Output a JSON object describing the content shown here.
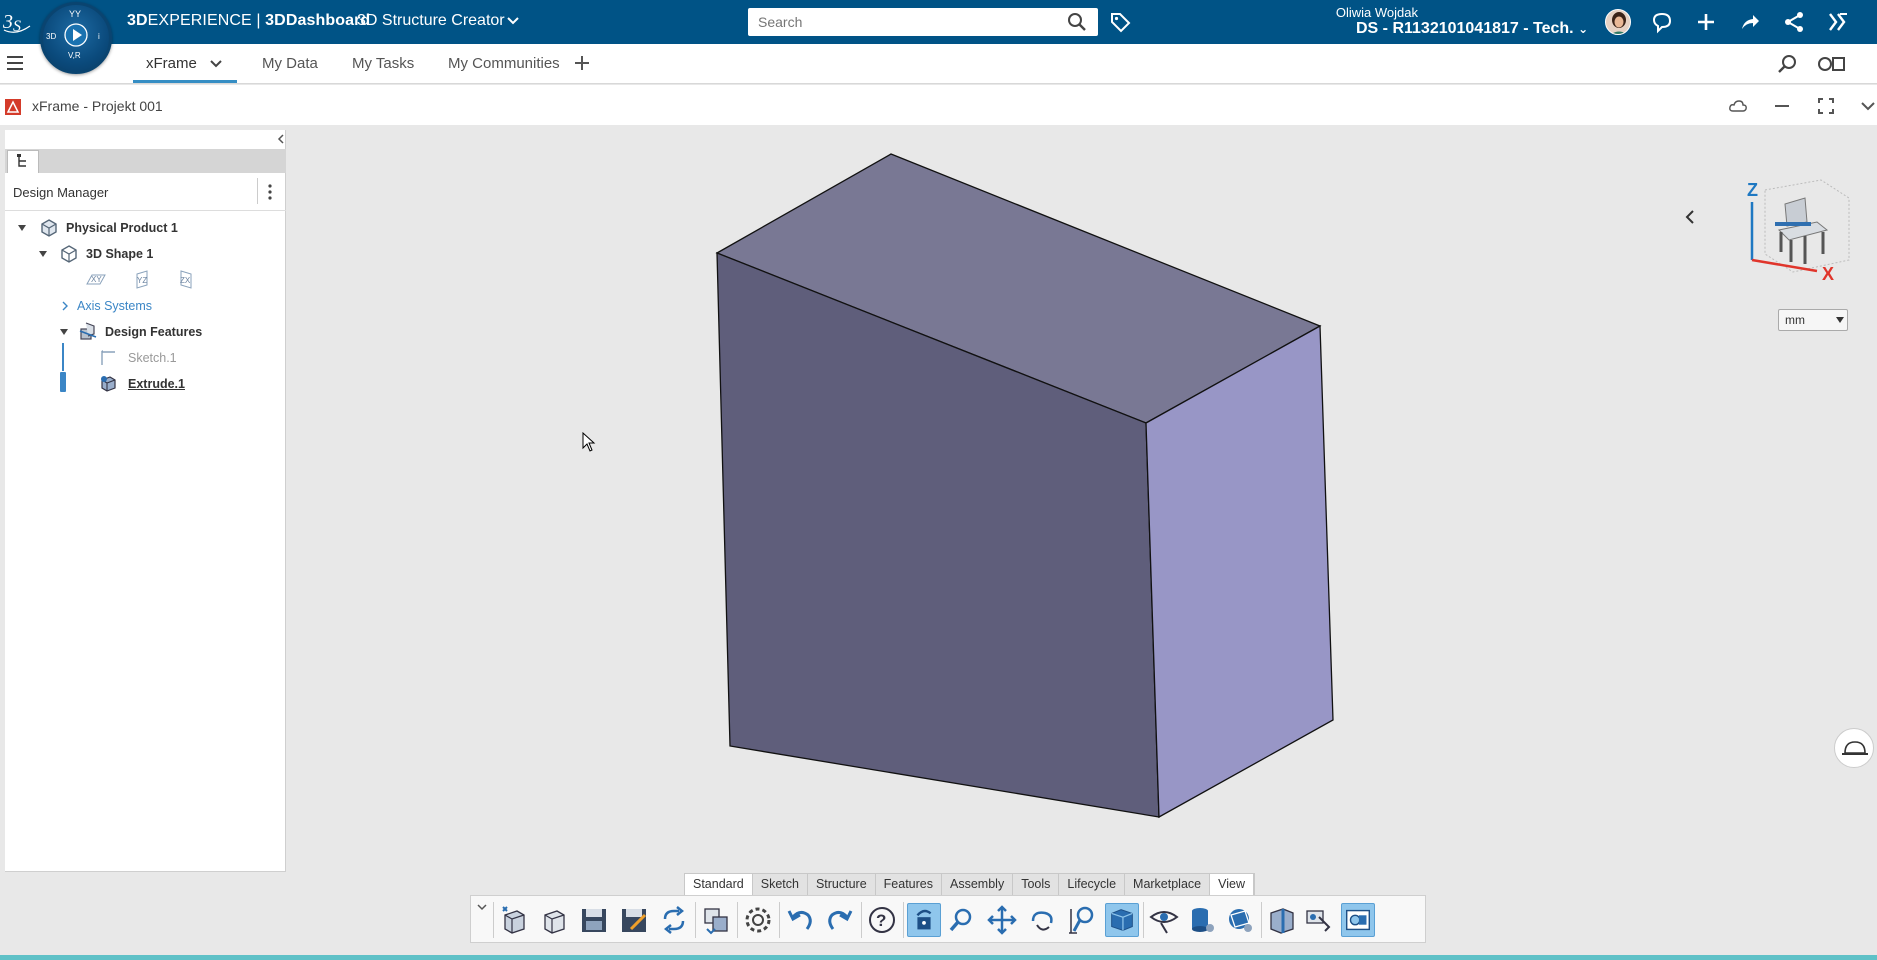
{
  "topbar": {
    "brand_bold": "3D",
    "brand_rest": "EXPERIENCE",
    "brand_sep": " | ",
    "brand_dash_bold": "3D",
    "brand_dash_rest": "Dashboard",
    "app_name": "3D Structure Creator",
    "compass_labels": {
      "top": "V,R",
      "left": "3D",
      "center": "i"
    },
    "search_placeholder": "Search",
    "user_name": "Oliwia Wojdak",
    "tenant": "DS - R1132101041817 - Tech.",
    "icons": [
      "search-icon",
      "tag-icon",
      "chat-icon",
      "add-icon",
      "share-icon",
      "network-icon",
      "tools-icon"
    ],
    "brand_color": "#005386"
  },
  "tabs": {
    "items": [
      "xFrame",
      "My Data",
      "My Tasks",
      "My Communities"
    ],
    "active": "xFrame"
  },
  "window": {
    "title": "xFrame - Projekt 001"
  },
  "design_manager": {
    "title": "Design Manager",
    "tree": [
      {
        "label": "Physical Product 1",
        "bold": true,
        "expanded": true
      },
      {
        "label": "3D Shape 1",
        "bold": true,
        "expanded": true
      },
      {
        "planes": [
          "XY",
          "YZ",
          "ZX"
        ]
      },
      {
        "label": "Axis Systems",
        "expanded": false,
        "color": "#3b86c6"
      },
      {
        "label": "Design Features",
        "bold": true,
        "expanded": true
      },
      {
        "label": "Sketch.1",
        "muted": true
      },
      {
        "label": "Extrude.1",
        "bold": true,
        "current": true
      }
    ]
  },
  "viewport": {
    "units": "mm",
    "axis_labels": {
      "z": "Z",
      "x": "X"
    },
    "cube_colors": {
      "top": "#797894",
      "front": "#5f5e7b",
      "side": "#9896c6"
    }
  },
  "action_bar": {
    "tabs": [
      "Standard",
      "Sketch",
      "Structure",
      "Features",
      "Assembly",
      "Tools",
      "Lifecycle",
      "Marketplace",
      "View"
    ],
    "active_tab": "Standard"
  }
}
